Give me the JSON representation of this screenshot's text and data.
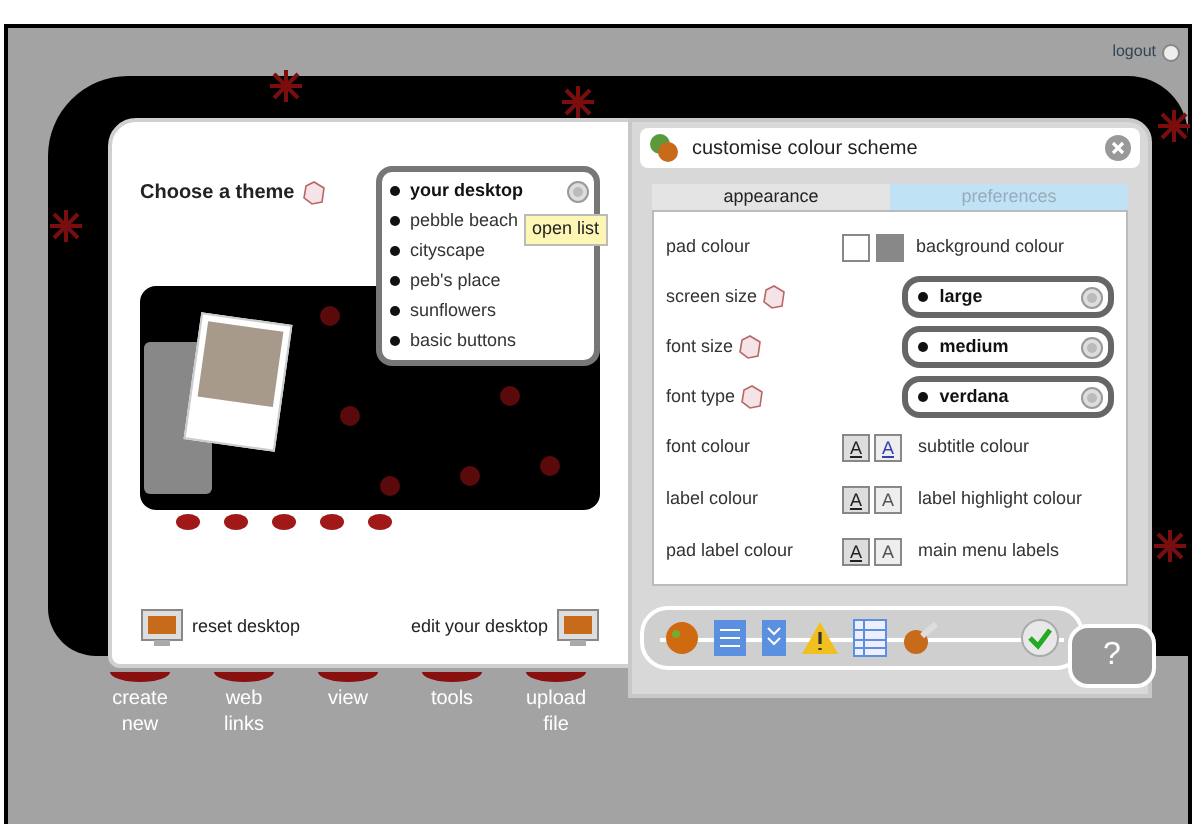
{
  "logout": "logout",
  "theme_panel": {
    "title": "Choose a theme",
    "themes": [
      {
        "label": "your desktop",
        "selected": true
      },
      {
        "label": "pebble beach",
        "selected": false
      },
      {
        "label": "cityscape",
        "selected": false
      },
      {
        "label": "peb's place",
        "selected": false
      },
      {
        "label": "sunflowers",
        "selected": false
      },
      {
        "label": "basic buttons",
        "selected": false
      }
    ],
    "tooltip": "open list",
    "reset": "reset desktop",
    "edit": "edit your desktop"
  },
  "colour_panel": {
    "title": "customise colour scheme",
    "tabs": [
      {
        "label": "appearance",
        "selected": true
      },
      {
        "label": "preferences",
        "selected": false
      }
    ],
    "rows": [
      {
        "kind": "swatch",
        "label": "pad colour",
        "label_2": "background colour"
      },
      {
        "kind": "select",
        "label": "screen size",
        "value": "large"
      },
      {
        "kind": "select",
        "label": "font size",
        "value": "medium"
      },
      {
        "kind": "select",
        "label": "font type",
        "value": "verdana"
      },
      {
        "kind": "font",
        "label": "font colour",
        "label_2": "subtitle colour",
        "key": "A",
        "key_2": "A"
      },
      {
        "kind": "font",
        "label": "label colour",
        "label_2": "label highlight colour",
        "key": "A",
        "key_2": "A"
      },
      {
        "kind": "font",
        "label": "pad label colour",
        "label_2": "main menu labels",
        "key": "A",
        "key_2": "A"
      }
    ],
    "help": "?"
  },
  "menu": [
    "create new",
    "web links",
    "view",
    "tools",
    "upload file"
  ]
}
